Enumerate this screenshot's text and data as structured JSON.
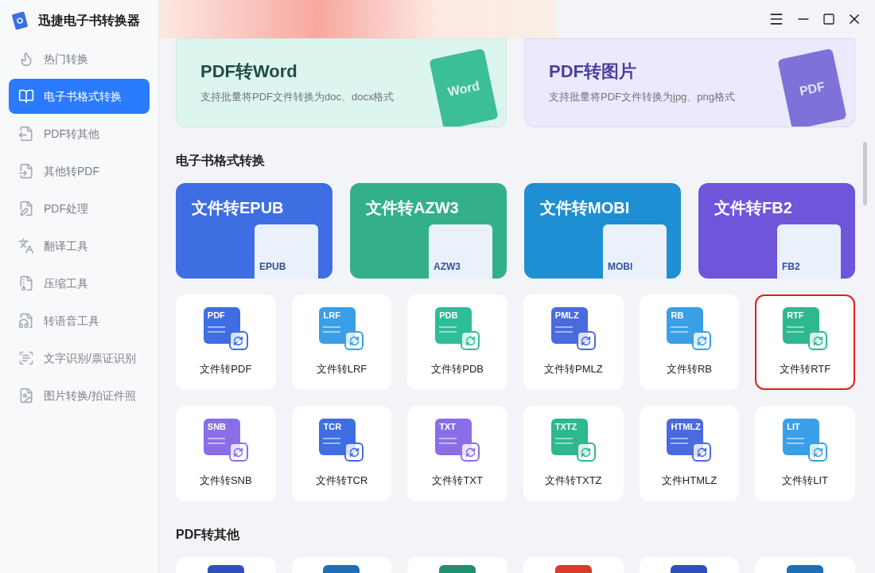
{
  "app": {
    "title": "迅捷电子书转换器"
  },
  "sidebar": {
    "items": [
      {
        "label": "热门转换",
        "selected": false
      },
      {
        "label": "电子书格式转换",
        "selected": true
      },
      {
        "label": "PDF转其他",
        "selected": false
      },
      {
        "label": "其他转PDF",
        "selected": false
      },
      {
        "label": "PDF处理",
        "selected": false
      },
      {
        "label": "翻译工具",
        "selected": false
      },
      {
        "label": "压缩工具",
        "selected": false
      },
      {
        "label": "转语音工具",
        "selected": false
      },
      {
        "label": "文字识别/票证识别",
        "selected": false
      },
      {
        "label": "图片转换/拍证件照",
        "selected": false
      }
    ]
  },
  "feature_cards": [
    {
      "title": "PDF转Word",
      "description": "支持批量将PDF文件转换为doc、docx格式",
      "badge": "Word",
      "kind": "word"
    },
    {
      "title": "PDF转图片",
      "description": "支持批量将PDF文件转换为jpg、png格式",
      "badge": "PDF",
      "kind": "image"
    }
  ],
  "sections": [
    {
      "heading": "电子书格式转换",
      "banners": [
        {
          "title": "文件转EPUB",
          "badge": "EPUB",
          "color": "#3f6ee2"
        },
        {
          "title": "文件转AZW3",
          "badge": "AZW3",
          "color": "#33b089"
        },
        {
          "title": "文件转MOBI",
          "badge": "MOBI",
          "color": "#1e8fd2"
        },
        {
          "title": "文件转FB2",
          "badge": "FB2",
          "color": "#6e55da"
        }
      ],
      "tiles": [
        {
          "label": "文件转PDF",
          "badge": "PDF",
          "color": "#3f6ee2",
          "selected": false
        },
        {
          "label": "文件转LRF",
          "badge": "LRF",
          "color": "#3a9fe6",
          "selected": false
        },
        {
          "label": "文件转PDB",
          "badge": "PDB",
          "color": "#2dbd98",
          "selected": false
        },
        {
          "label": "文件转PMLZ",
          "badge": "PMLZ",
          "color": "#4a6ae0",
          "selected": false
        },
        {
          "label": "文件转RB",
          "badge": "RB",
          "color": "#3a9fe6",
          "selected": false
        },
        {
          "label": "文件转RTF",
          "badge": "RTF",
          "color": "#2db890",
          "selected": true
        },
        {
          "label": "文件转SNB",
          "badge": "SNB",
          "color": "#8a6ee8",
          "selected": false
        },
        {
          "label": "文件转TCR",
          "badge": "TCR",
          "color": "#3f6ee2",
          "selected": false
        },
        {
          "label": "文件转TXT",
          "badge": "TXT",
          "color": "#8a6ee8",
          "selected": false
        },
        {
          "label": "文件转TXTZ",
          "badge": "TXTZ",
          "color": "#2db890",
          "selected": false
        },
        {
          "label": "文件HTMLZ",
          "badge": "HTMLZ",
          "color": "#4a6ae0",
          "selected": false
        },
        {
          "label": "文件转LIT",
          "badge": "LIT",
          "color": "#3a9fe6",
          "selected": false
        }
      ]
    },
    {
      "heading": "PDF转其他",
      "tiles": [
        {
          "color": "#2f4fbf"
        },
        {
          "color": "#1e6fb8"
        },
        {
          "color": "#1f8f6f"
        },
        {
          "color": "#d83b2a"
        },
        {
          "color": "#2f4fbf"
        },
        {
          "color": "#1e6fb8"
        }
      ]
    }
  ]
}
